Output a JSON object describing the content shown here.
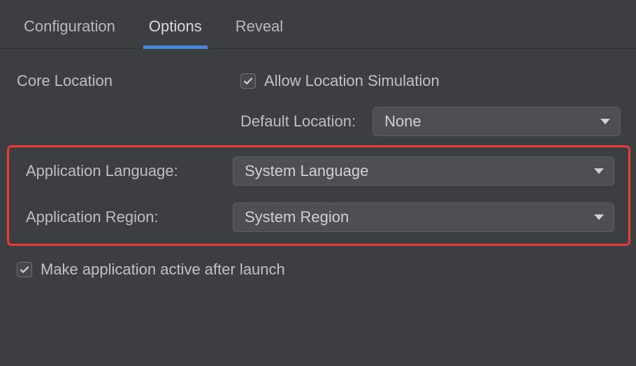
{
  "tabs": {
    "configuration": "Configuration",
    "options": "Options",
    "reveal": "Reveal"
  },
  "core_location": {
    "label": "Core Location",
    "allow_sim_label": "Allow Location Simulation",
    "default_loc_label": "Default Location:",
    "default_loc_value": "None"
  },
  "app_language": {
    "label": "Application Language:",
    "value": "System Language"
  },
  "app_region": {
    "label": "Application Region:",
    "value": "System Region"
  },
  "make_active": {
    "label": "Make application active after launch"
  }
}
